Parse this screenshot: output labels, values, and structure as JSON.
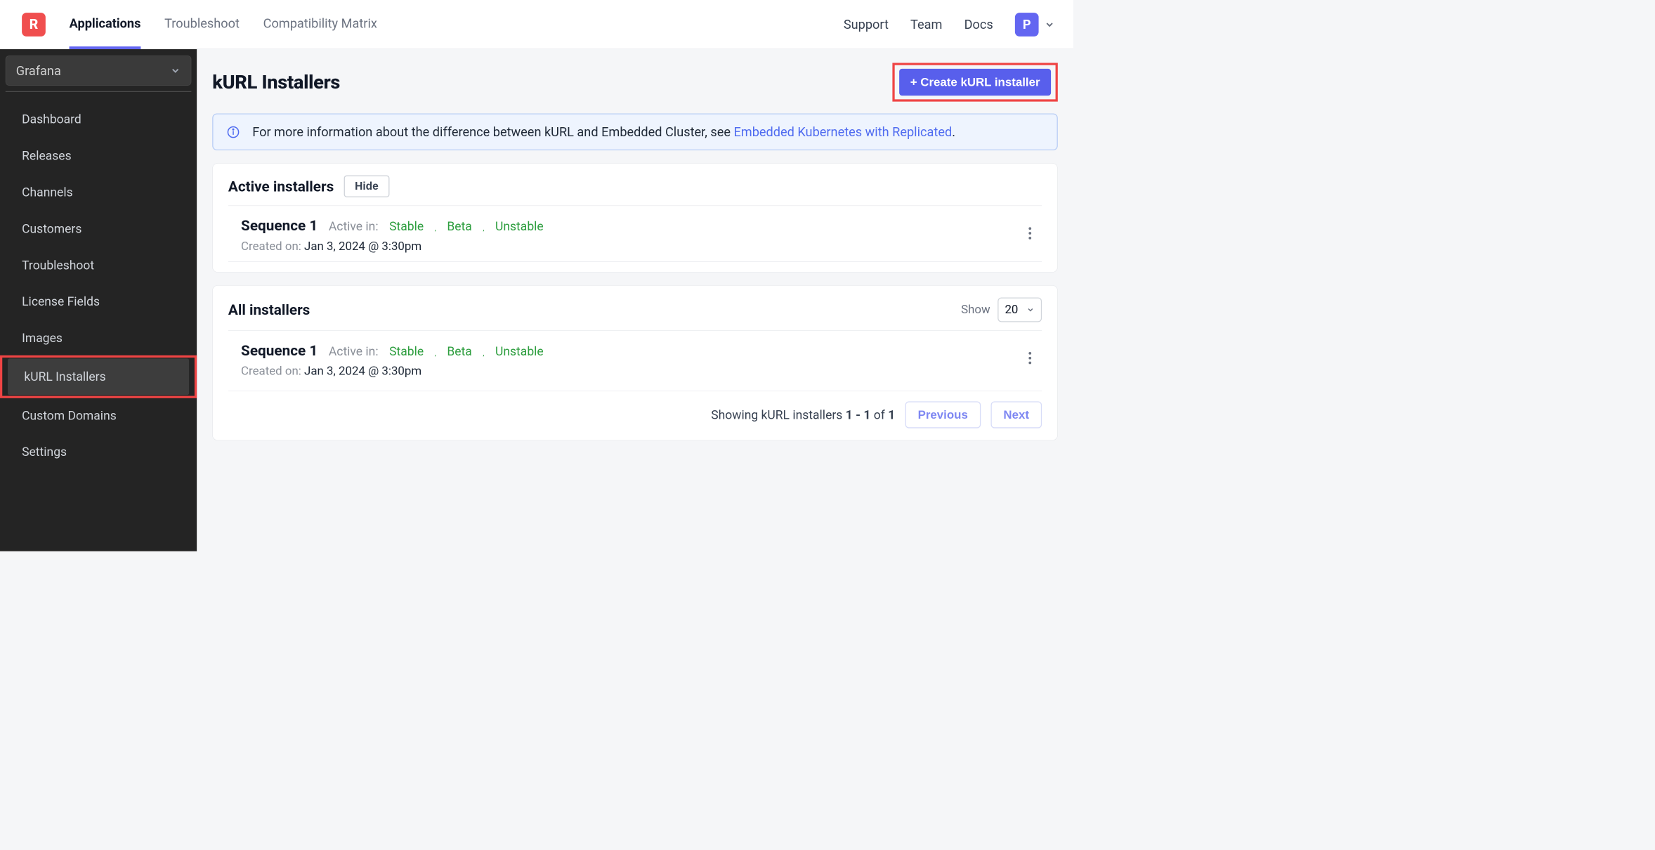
{
  "brand": {
    "logo_letter": "R"
  },
  "topnav": {
    "items": [
      {
        "label": "Applications",
        "active": true
      },
      {
        "label": "Troubleshoot"
      },
      {
        "label": "Compatibility Matrix"
      }
    ]
  },
  "topright": {
    "links": [
      {
        "label": "Support"
      },
      {
        "label": "Team"
      },
      {
        "label": "Docs"
      }
    ],
    "avatar_letter": "P"
  },
  "sidebar": {
    "app_selector": "Grafana",
    "items": [
      {
        "label": "Dashboard"
      },
      {
        "label": "Releases"
      },
      {
        "label": "Channels"
      },
      {
        "label": "Customers"
      },
      {
        "label": "Troubleshoot"
      },
      {
        "label": "License Fields"
      },
      {
        "label": "Images"
      },
      {
        "label": "kURL Installers",
        "active": true,
        "highlighted": true
      },
      {
        "label": "Custom Domains"
      },
      {
        "label": "Settings"
      }
    ]
  },
  "page": {
    "title": "kURL Installers",
    "create_button": "+ Create kURL installer"
  },
  "info_banner": {
    "text_prefix": "For more information about the difference between kURL and Embedded Cluster, see ",
    "link_text": "Embedded Kubernetes with Replicated",
    "text_suffix": "."
  },
  "active_installers": {
    "title": "Active installers",
    "toggle_label": "Hide",
    "rows": [
      {
        "name": "Sequence 1",
        "active_in_label": "Active in:",
        "channels": [
          "Stable",
          "Beta",
          "Unstable"
        ],
        "created_label": "Created on:",
        "created_value": "Jan 3, 2024 @ 3:30pm"
      }
    ]
  },
  "all_installers": {
    "title": "All installers",
    "show_label": "Show",
    "page_size": "20",
    "rows": [
      {
        "name": "Sequence 1",
        "active_in_label": "Active in:",
        "channels": [
          "Stable",
          "Beta",
          "Unstable"
        ],
        "created_label": "Created on:",
        "created_value": "Jan 3, 2024 @ 3:30pm"
      }
    ],
    "pagination": {
      "text_prefix": "Showing kURL installers ",
      "range": "1 - 1",
      "of_label": " of ",
      "total": "1",
      "prev_label": "Previous",
      "next_label": "Next"
    }
  }
}
